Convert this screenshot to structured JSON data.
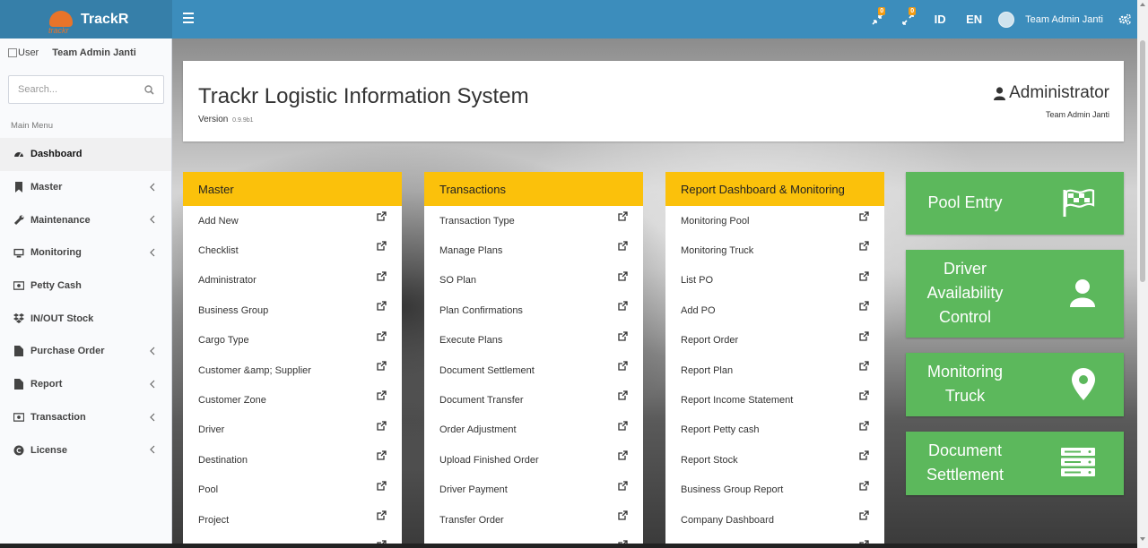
{
  "topbar": {
    "brand": "TrackR",
    "brand_sub": "trackr",
    "notif_1_count": "0",
    "notif_2_count": "0",
    "lang_id": "ID",
    "lang_en": "EN",
    "user_name": "Team Admin Janti",
    "colors": {
      "bar": "#3c8dbc",
      "logo_bg": "#367fa9",
      "badge": "#f39c12"
    }
  },
  "sidebar": {
    "user_img_alt": "User",
    "user_name": "Team Admin Janti",
    "search_placeholder": "Search...",
    "menu_header": "Main Menu",
    "items": [
      {
        "label": "Dashboard",
        "icon": "dashboard-icon",
        "has_children": false,
        "active": true
      },
      {
        "label": "Master",
        "icon": "bookmark-icon",
        "has_children": true
      },
      {
        "label": "Maintenance",
        "icon": "wrench-icon",
        "has_children": true
      },
      {
        "label": "Monitoring",
        "icon": "monitor-icon",
        "has_children": true
      },
      {
        "label": "Petty Cash",
        "icon": "money-icon",
        "has_children": false
      },
      {
        "label": "IN/OUT Stock",
        "icon": "dropbox-icon",
        "has_children": false
      },
      {
        "label": "Purchase Order",
        "icon": "file-icon",
        "has_children": true
      },
      {
        "label": "Report",
        "icon": "file-icon",
        "has_children": true
      },
      {
        "label": "Transaction",
        "icon": "money-icon",
        "has_children": true
      },
      {
        "label": "License",
        "icon": "copyright-icon",
        "has_children": true
      }
    ]
  },
  "header": {
    "title": "Trackr Logistic Information System",
    "version_label": "Version",
    "version_number": "0.9.9b1",
    "role": "Administrator",
    "role_sub": "Team Admin Janti"
  },
  "panels": [
    {
      "title": "Master",
      "items": [
        "Add New",
        "Checklist",
        "Administrator",
        "Business Group",
        "Cargo Type",
        "Customer &amp; Supplier",
        "Customer Zone",
        "Driver",
        "Destination",
        "Pool",
        "Project"
      ]
    },
    {
      "title": "Transactions",
      "items": [
        "Transaction Type",
        "Manage Plans",
        "SO Plan",
        "Plan Confirmations",
        "Execute Plans",
        "Document Settlement",
        "Document Transfer",
        "Order Adjustment",
        "Upload Finished Order",
        "Driver Payment",
        "Transfer Order"
      ]
    },
    {
      "title": "Report Dashboard & Monitoring",
      "items": [
        "Monitoring Pool",
        "Monitoring Truck",
        "List PO",
        "Add PO",
        "Report Order",
        "Report Plan",
        "Report Income Statement",
        "Report Petty cash",
        "Report Stock",
        "Business Group Report",
        "Company Dashboard"
      ]
    }
  ],
  "tiles": [
    {
      "label": "Pool Entry",
      "icon": "flag-checkered-icon"
    },
    {
      "label": "Driver Availability Control",
      "icon": "user-icon"
    },
    {
      "label": "Monitoring Truck",
      "icon": "map-marker-icon"
    },
    {
      "label": "Document Settlement",
      "icon": "server-icon"
    }
  ],
  "colors": {
    "panel_header": "#fbc10b",
    "tile": "#5cb85c"
  }
}
